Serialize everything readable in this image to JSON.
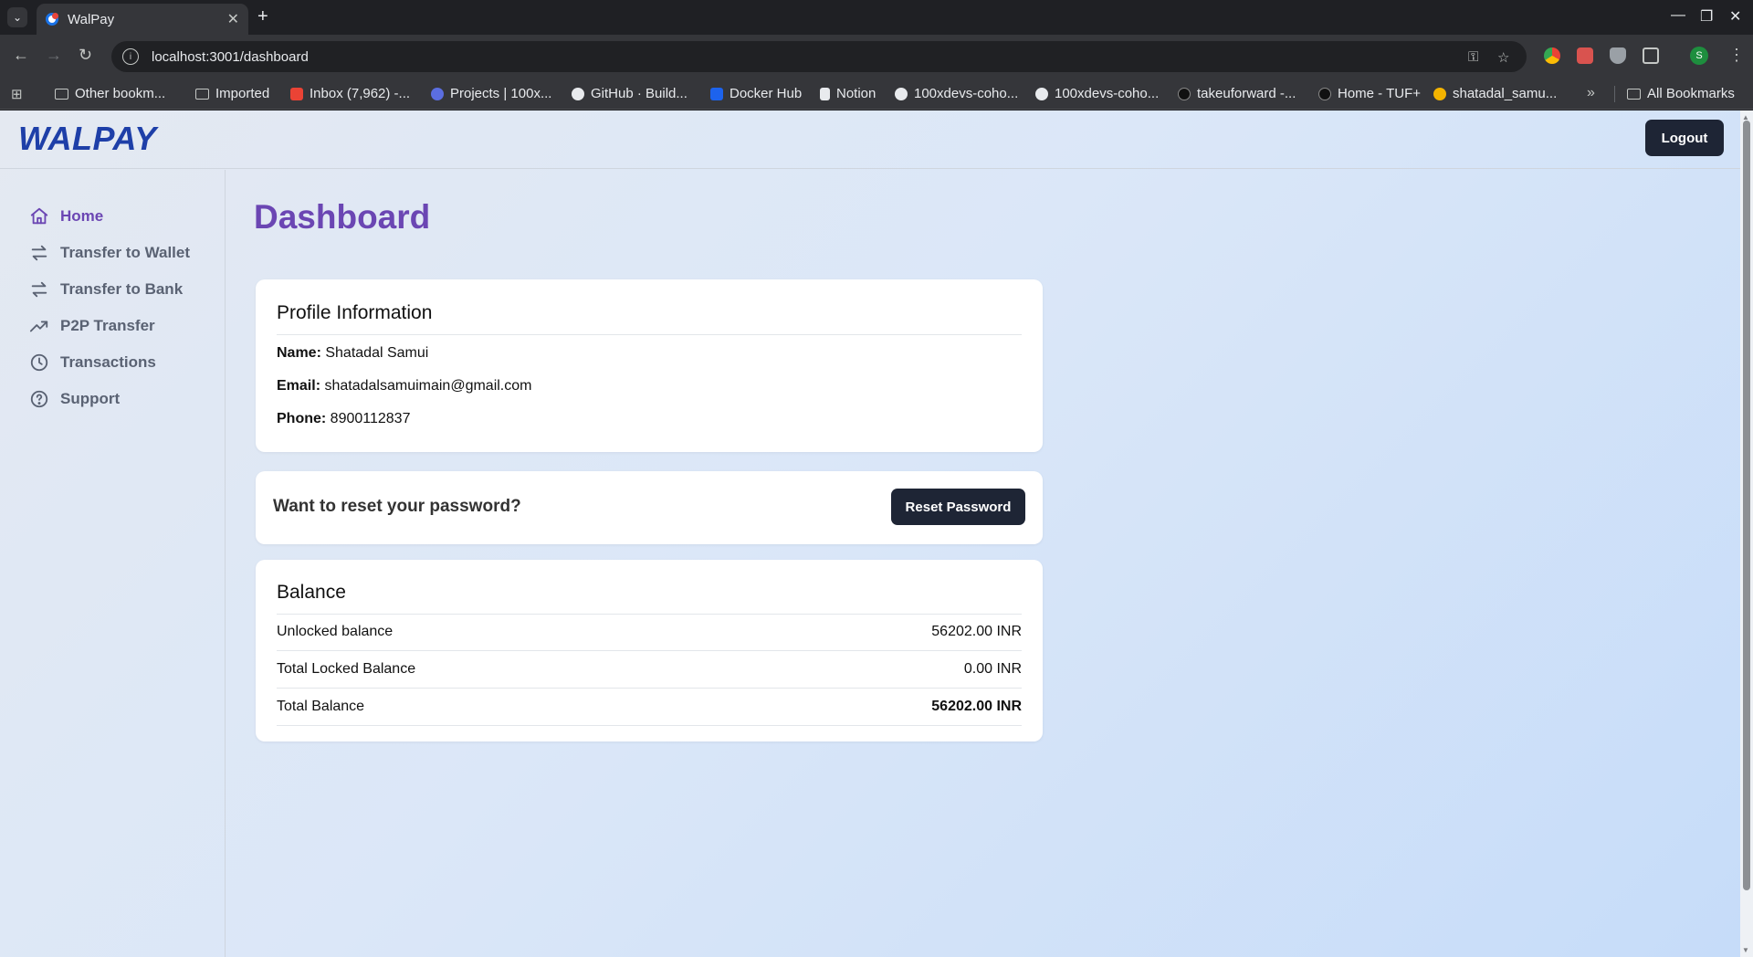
{
  "browser": {
    "tab_title": "WalPay",
    "url": "localhost:3001/dashboard",
    "profile_initial": "S",
    "bookmarks": [
      "Other bookm...",
      "Imported",
      "Inbox (7,962) -...",
      "Projects | 100x...",
      "GitHub · Build...",
      "Docker Hub",
      "Notion",
      "100xdevs-coho...",
      "100xdevs-coho...",
      "takeuforward -...",
      "Home - TUF+",
      "shatadal_samu..."
    ],
    "all_bookmarks": "All Bookmarks"
  },
  "app": {
    "logo": "WALPAY",
    "logout_label": "Logout",
    "sidebar": [
      {
        "label": "Home",
        "icon": "home-icon",
        "active": true
      },
      {
        "label": "Transfer to Wallet",
        "icon": "arrows-swap-icon",
        "active": false
      },
      {
        "label": "Transfer to Bank",
        "icon": "arrows-swap-icon",
        "active": false
      },
      {
        "label": "P2P Transfer",
        "icon": "trending-up-icon",
        "active": false
      },
      {
        "label": "Transactions",
        "icon": "clock-icon",
        "active": false
      },
      {
        "label": "Support",
        "icon": "help-circle-icon",
        "active": false
      }
    ],
    "page_title": "Dashboard",
    "profile": {
      "heading": "Profile Information",
      "name_label": "Name:",
      "name": "Shatadal Samui",
      "email_label": "Email:",
      "email": "shatadalsamuimain@gmail.com",
      "phone_label": "Phone:",
      "phone": "8900112837"
    },
    "reset": {
      "question": "Want to reset your password?",
      "button": "Reset Password"
    },
    "balance": {
      "heading": "Balance",
      "rows": [
        {
          "label": "Unlocked balance",
          "value": "56202.00 INR"
        },
        {
          "label": "Total Locked Balance",
          "value": "0.00 INR"
        },
        {
          "label": "Total Balance",
          "value": "56202.00 INR"
        }
      ]
    },
    "colors": {
      "accent": "#6b46b3",
      "logo": "#1e3fa8",
      "button_dark": "#1e2535"
    }
  }
}
